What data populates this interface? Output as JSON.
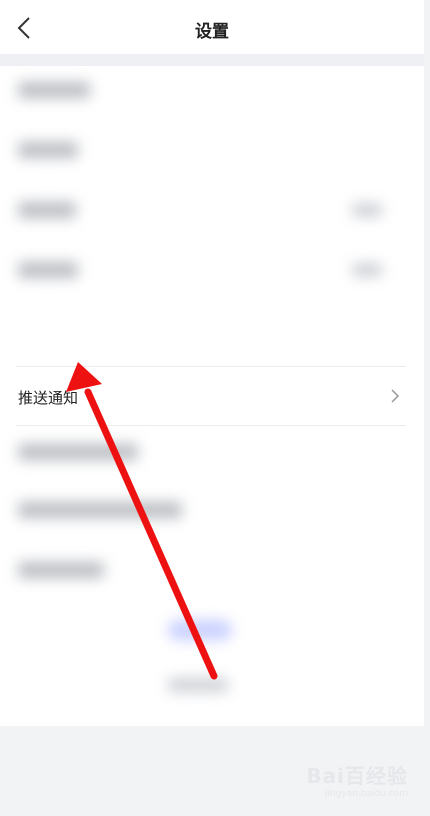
{
  "header": {
    "title": "设置"
  },
  "list": {
    "push_notification_label": "推送通知"
  },
  "watermark": {
    "main": "Bai百经验",
    "sub": "jingyan.baidu.com"
  },
  "colors": {
    "annotation_arrow": "#ee1111",
    "background": "#f2f3f5"
  }
}
